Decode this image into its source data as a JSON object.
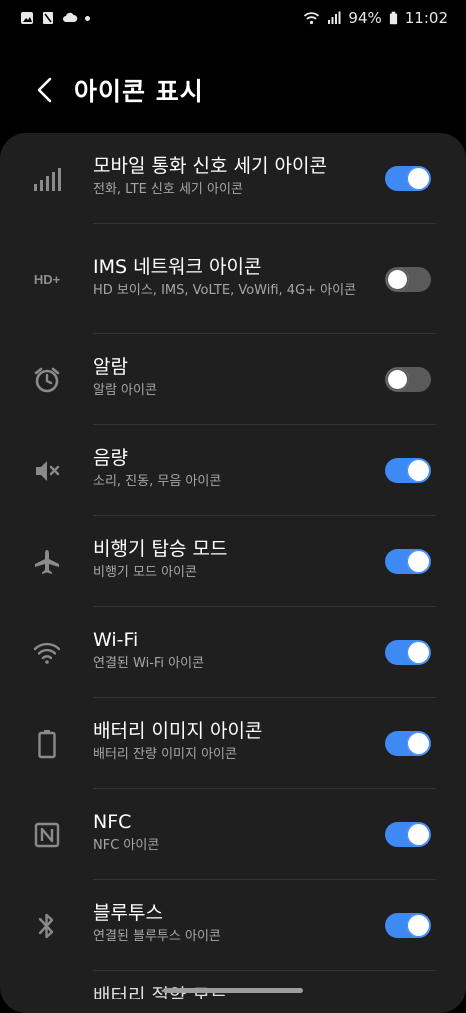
{
  "status_bar": {
    "battery": "94%",
    "time": "11:02",
    "left_icons": [
      "image-icon",
      "mic-off-icon",
      "cloud-icon",
      "dot"
    ],
    "right_icons": [
      "wifi-icon",
      "signal-icon",
      "battery-icon"
    ]
  },
  "header": {
    "title": "아이콘 표시",
    "back_icon": "chevron-left-icon"
  },
  "colors": {
    "background": "#000000",
    "card": "#1f1f1f",
    "toggle_on": "#3e8af5",
    "toggle_off": "#5a5a5a",
    "subtitle": "#a6a6a6"
  },
  "items": [
    {
      "icon": "signal-bars-icon",
      "title": "모바일 통화 신호 세기 아이콘",
      "subtitle": "전화, LTE 신호 세기 아이콘",
      "enabled": true
    },
    {
      "icon": "hd-plus-icon",
      "icon_text": "HD+",
      "title": "IMS 네트워크 아이콘",
      "subtitle": "HD 보이스, IMS, VoLTE, VoWifi, 4G+ 아이콘",
      "enabled": false
    },
    {
      "icon": "alarm-icon",
      "title": "알람",
      "subtitle": "알람 아이콘",
      "enabled": false
    },
    {
      "icon": "volume-mute-icon",
      "title": "음량",
      "subtitle": "소리, 진동, 무음 아이콘",
      "enabled": true
    },
    {
      "icon": "airplane-icon",
      "title": "비행기 탑승 모드",
      "subtitle": "비행기 모드 아이콘",
      "enabled": true
    },
    {
      "icon": "wifi-icon",
      "title": "Wi-Fi",
      "subtitle": "연결된 Wi-Fi 아이콘",
      "enabled": true
    },
    {
      "icon": "battery-icon",
      "title": "배터리 이미지 아이콘",
      "subtitle": "배터리 잔량 이미지 아이콘",
      "enabled": true
    },
    {
      "icon": "nfc-icon",
      "title": "NFC",
      "subtitle": "NFC 아이콘",
      "enabled": true
    },
    {
      "icon": "bluetooth-icon",
      "title": "블루투스",
      "subtitle": "연결된 블루투스 아이콘",
      "enabled": true
    }
  ],
  "peek_item": {
    "title": "배터리 절약 모드"
  }
}
